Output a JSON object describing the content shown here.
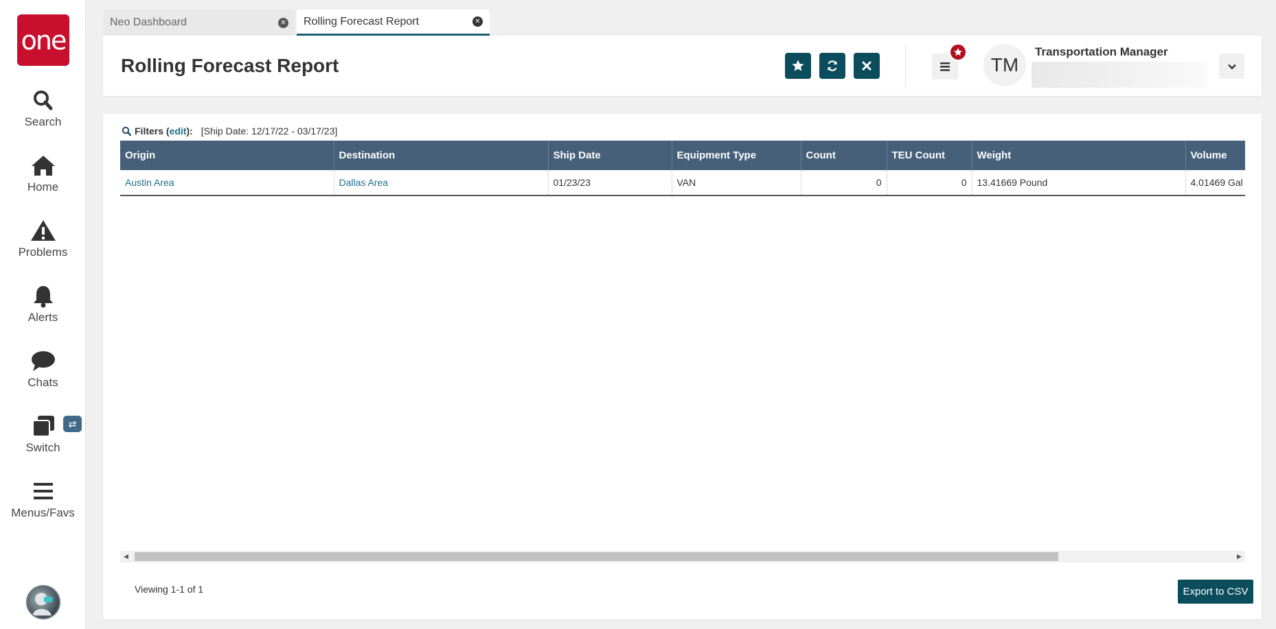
{
  "app": {
    "logo_text": "one",
    "brand_color": "#c8102e",
    "accent_color": "#0b4d5c"
  },
  "sidebar": {
    "items": [
      {
        "label": "Search",
        "icon": "search-icon"
      },
      {
        "label": "Home",
        "icon": "home-icon"
      },
      {
        "label": "Problems",
        "icon": "warning-icon"
      },
      {
        "label": "Alerts",
        "icon": "bell-icon"
      },
      {
        "label": "Chats",
        "icon": "chat-icon"
      },
      {
        "label": "Switch",
        "icon": "switch-icon"
      },
      {
        "label": "Menus/Favs",
        "icon": "menu-icon"
      }
    ],
    "switch_badge": "⇄"
  },
  "tabs": [
    {
      "label": "Neo Dashboard",
      "active": false
    },
    {
      "label": "Rolling Forecast Report",
      "active": true
    }
  ],
  "header": {
    "title": "Rolling Forecast Report",
    "user": {
      "initials": "TM",
      "role": "Transportation Manager"
    }
  },
  "filters": {
    "label": "Filters (",
    "edit": "edit",
    "close": "):",
    "value": "[Ship Date: 12/17/22 - 03/17/23]"
  },
  "table": {
    "columns": [
      "Origin",
      "Destination",
      "Ship Date",
      "Equipment Type",
      "Count",
      "TEU Count",
      "Weight",
      "Volume"
    ],
    "rows": [
      [
        "Austin Area",
        "Dallas Area",
        "01/23/23",
        "VAN",
        "0",
        "0",
        "13.41669 Pound",
        "4.01469 Gal"
      ]
    ]
  },
  "footer": {
    "viewing": "Viewing 1-1 of 1",
    "export_label": "Export to CSV"
  }
}
